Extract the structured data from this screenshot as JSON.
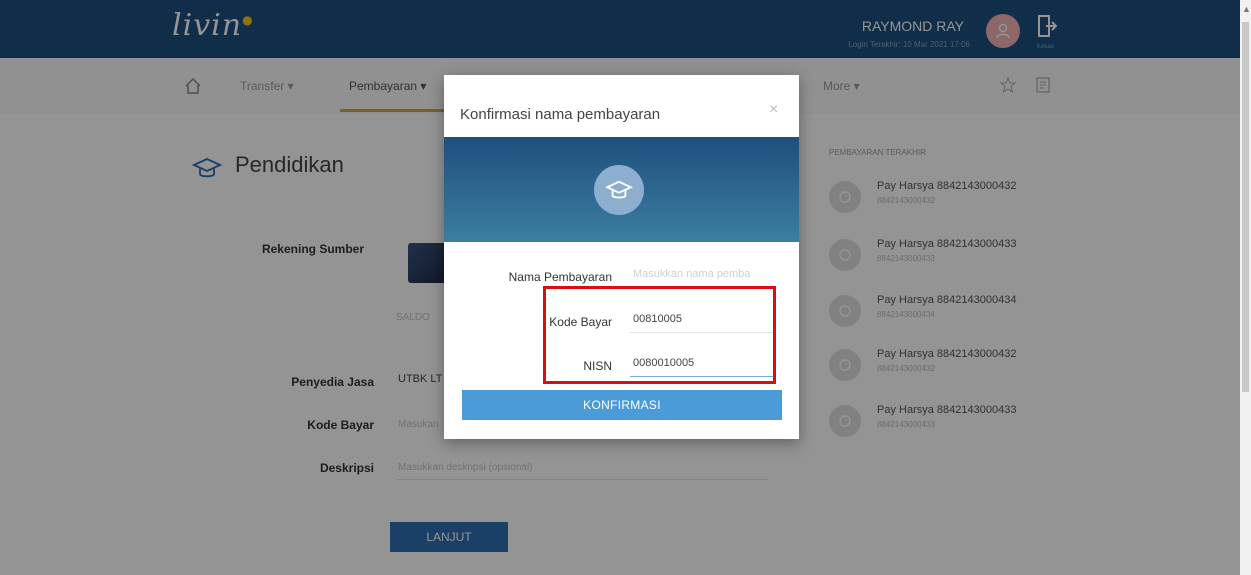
{
  "header": {
    "logo": "livin'",
    "username": "RAYMOND RAY",
    "last_login": "Login Terakhir: 10 Mar 2021 17:06",
    "logout_label": "Keluar"
  },
  "nav": {
    "items": [
      {
        "label": "Transfer ▾"
      },
      {
        "label": "Pembayaran ▾"
      },
      {
        "label": "More ▾"
      }
    ]
  },
  "page": {
    "title": "Pendidikan",
    "labels": {
      "rekening": "Rekening Sumber",
      "penyedia": "Penyedia Jasa",
      "kode": "Kode Bayar",
      "deskripsi": "Deskripsi"
    },
    "saldo": "SALDO",
    "penyedia_value": "UTBK LT",
    "kode_placeholder": "Masukan",
    "deskripsi_placeholder": "Masukkan deskripsi (opsional)",
    "lanjut_label": "LANJUT"
  },
  "recent": {
    "title": "PEMBAYARAN TERAKHIR",
    "items": [
      {
        "name": "Pay Harsya 8842143000432",
        "sub": "8842143000432"
      },
      {
        "name": "Pay Harsya 8842143000433",
        "sub": "8842143000433"
      },
      {
        "name": "Pay Harsya 8842143000434",
        "sub": "8842143000434"
      },
      {
        "name": "Pay Harsya 8842143000432",
        "sub": "8842143000432"
      },
      {
        "name": "Pay Harsya 8842143000433",
        "sub": "8842143000433"
      }
    ]
  },
  "modal": {
    "title": "Konfirmasi nama pembayaran",
    "close": "×",
    "fields": {
      "nama_label": "Nama Pembayaran",
      "nama_placeholder": "Masukkan nama pemba",
      "kode_label": "Kode Bayar",
      "kode_value": "00810005",
      "nisn_label": "NISN",
      "nisn_value": "0080010005"
    },
    "confirm_label": "KONFIRMASI"
  },
  "colors": {
    "header_bg": "#1d4e7e",
    "accent_underline": "#d1a54a",
    "primary_button": "#2f6fb3",
    "confirm_button": "#4b9bd8",
    "highlight": "#d90f0f"
  }
}
